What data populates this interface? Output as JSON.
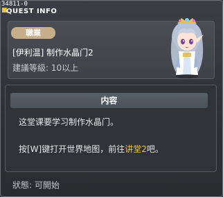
{
  "quest_id": "34811-0",
  "window_title": "QUEST INFO",
  "header": {
    "job_badge": "職業",
    "quest_name": "[伊利温] 制作水晶门2",
    "level_text": "建議等級: 10以上"
  },
  "content": {
    "header_label": "内容",
    "description": "这堂课要学习制作水晶门。",
    "hint_prefix": "按[W]键打开世界地图，前往",
    "hint_highlight": "讲堂2",
    "hint_suffix": "吧。"
  },
  "status_text": "狀態:  可開始",
  "colors": {
    "highlight": "#f0c43a",
    "badge": "#c6ae8a"
  },
  "icons": {
    "title_icon": "quest-scroll-icon",
    "npc": "npc-portrait"
  }
}
